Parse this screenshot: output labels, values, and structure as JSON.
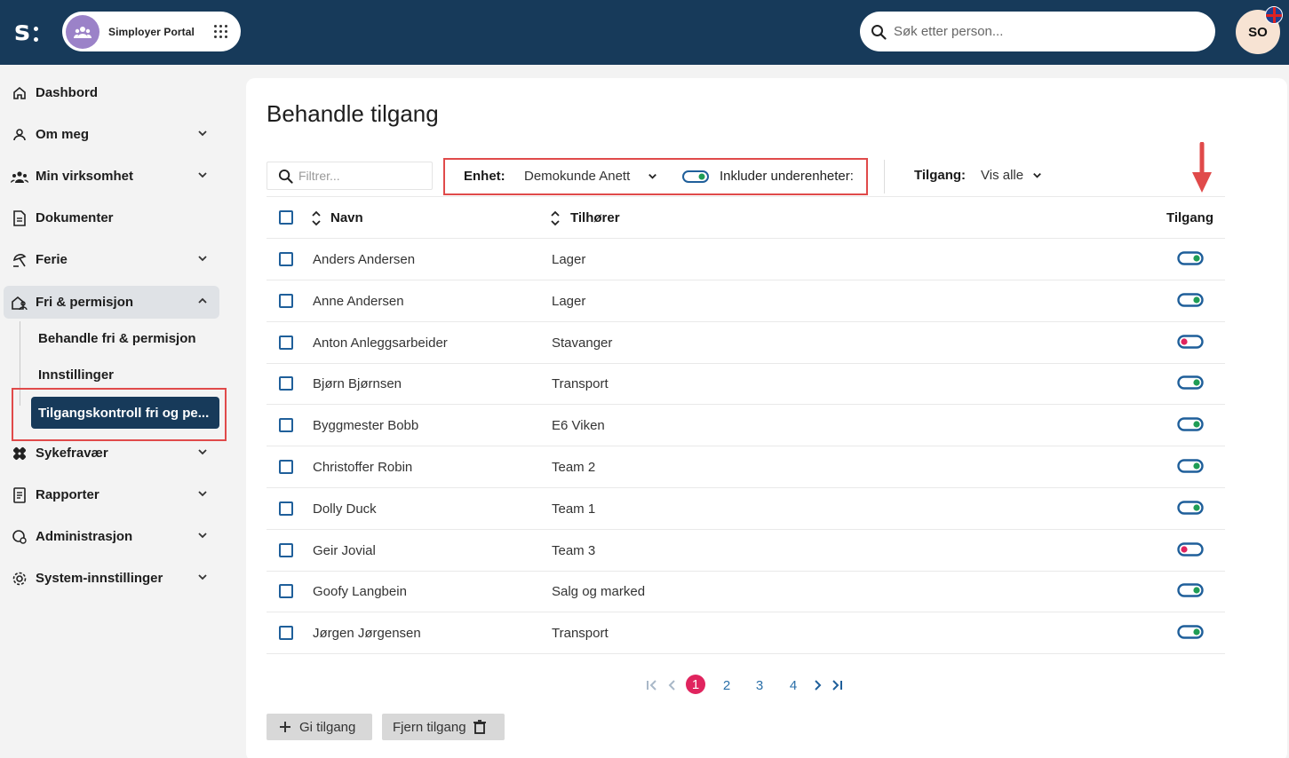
{
  "header": {
    "portal_label": "Simployer Portal",
    "search_placeholder": "Søk etter person...",
    "user_initials": "SO"
  },
  "sidebar": {
    "items": [
      {
        "label": "Dashbord",
        "icon": "home-icon",
        "expandable": false
      },
      {
        "label": "Om meg",
        "icon": "person-icon",
        "expandable": true
      },
      {
        "label": "Min virksomhet",
        "icon": "people-icon",
        "expandable": true
      },
      {
        "label": "Dokumenter",
        "icon": "document-icon",
        "expandable": false
      },
      {
        "label": "Ferie",
        "icon": "beach-icon",
        "expandable": true
      },
      {
        "label": "Fri & permisjon",
        "icon": "home-person-icon",
        "expandable": true,
        "expanded": true
      },
      {
        "label": "Sykefravær",
        "icon": "bandage-icon",
        "expandable": true
      },
      {
        "label": "Rapporter",
        "icon": "report-icon",
        "expandable": true
      },
      {
        "label": "Administrasjon",
        "icon": "admin-icon",
        "expandable": true
      },
      {
        "label": "System-innstillinger",
        "icon": "gear-icon",
        "expandable": true
      }
    ],
    "sub_items": [
      {
        "label": "Behandle fri & permisjon"
      },
      {
        "label": "Innstillinger"
      },
      {
        "label": "Tilgangskontroll fri og pe...",
        "active": true
      }
    ]
  },
  "main": {
    "title": "Behandle tilgang",
    "filter_placeholder": "Filtrer...",
    "enhet_label": "Enhet:",
    "enhet_value": "Demokunde Anett",
    "include_label": "Inkluder underenheter:",
    "include_on": true,
    "tilgang_label": "Tilgang:",
    "tilgang_value": "Vis alle"
  },
  "table": {
    "columns": {
      "name": "Navn",
      "owner": "Tilhører",
      "access": "Tilgang"
    },
    "rows": [
      {
        "name": "Anders Andersen",
        "owner": "Lager",
        "access": true
      },
      {
        "name": "Anne Andersen",
        "owner": "Lager",
        "access": true
      },
      {
        "name": "Anton Anleggsarbeider",
        "owner": "Stavanger",
        "access": false
      },
      {
        "name": "Bjørn Bjørnsen",
        "owner": "Transport",
        "access": true
      },
      {
        "name": "Byggmester Bobb",
        "owner": "E6 Viken",
        "access": true
      },
      {
        "name": "Christoffer Robin",
        "owner": "Team 2",
        "access": true
      },
      {
        "name": "Dolly Duck",
        "owner": "Team 1",
        "access": true
      },
      {
        "name": "Geir Jovial",
        "owner": "Team 3",
        "access": false
      },
      {
        "name": "Goofy Langbein",
        "owner": "Salg og marked",
        "access": true
      },
      {
        "name": "Jørgen Jørgensen",
        "owner": "Transport",
        "access": true
      }
    ]
  },
  "pagination": {
    "pages": [
      "1",
      "2",
      "3",
      "4"
    ],
    "current": "1"
  },
  "actions": {
    "give_label": "Gi tilgang",
    "remove_label": "Fjern tilgang"
  },
  "colors": {
    "topbar": "#173a5a",
    "toggle_on": "#1f9d55",
    "toggle_off": "#e0245e",
    "accent": "#1f5f9a",
    "highlight": "#e04a4a"
  }
}
